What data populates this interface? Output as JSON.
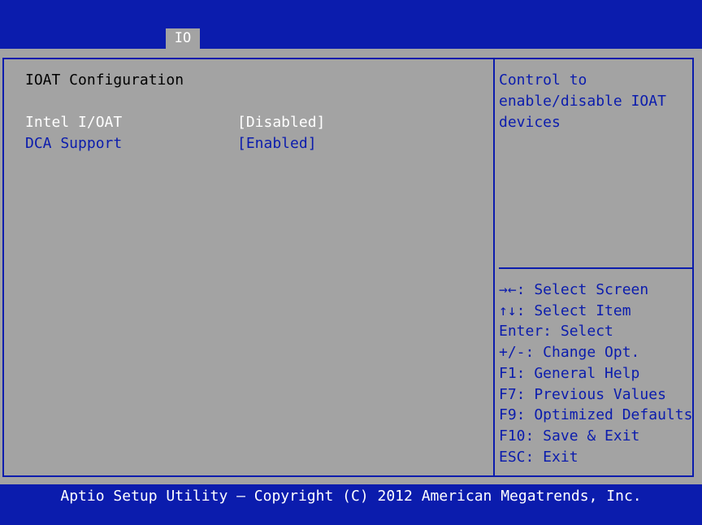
{
  "header": {
    "active_tab": "IO"
  },
  "main": {
    "section_title": "IOAT Configuration",
    "items": [
      {
        "label": "Intel I/OAT",
        "value": "[Disabled]"
      },
      {
        "label": "DCA Support",
        "value": "[Enabled]"
      }
    ]
  },
  "help_text": "Control to\nenable/disable IOAT\ndevices",
  "keys": [
    "→←: Select Screen",
    "↑↓: Select Item",
    "Enter: Select",
    "+/-: Change Opt.",
    "F1: General Help",
    "F7: Previous Values",
    "F9: Optimized Defaults",
    "F10: Save & Exit",
    "ESC: Exit"
  ],
  "footer": "Aptio Setup Utility – Copyright (C) 2012 American Megatrends, Inc.",
  "colors": {
    "bios_blue": "#0b1cad",
    "panel_gray": "#a3a3a3",
    "highlight": "#ffffff"
  }
}
